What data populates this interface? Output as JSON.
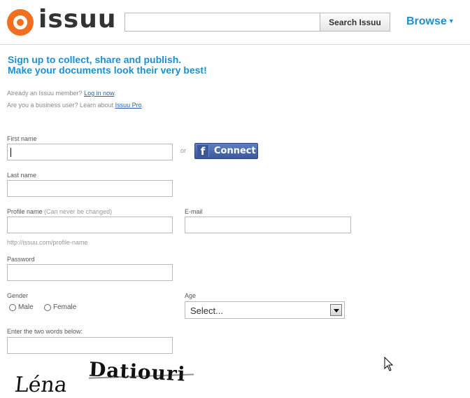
{
  "header": {
    "brand": "issuu",
    "search_placeholder": "",
    "search_button": "Search Issuu",
    "browse_label": "Browse"
  },
  "tagline": {
    "line1": "Sign up to collect, share and publish.",
    "line2": "Make your documents look their very best!"
  },
  "info": {
    "member_text": "Already an Issuu member?",
    "login_link": "Log in now",
    "business_text": "Are you a business user? Learn about",
    "pro_link": "Issuu Pro"
  },
  "form": {
    "first_name_label": "First name",
    "or_text": "or",
    "fb_connect": "Connect",
    "last_name_label": "Last name",
    "profile_name_label": "Profile name",
    "profile_name_hint": "(Can never be changed)",
    "email_label": "E-mail",
    "profile_url_hint": "http://issuu.com/profile-name",
    "password_label": "Password",
    "gender_label": "Gender",
    "gender_male": "Male",
    "gender_female": "Female",
    "age_label": "Age",
    "age_selected": "Select...",
    "captcha_label": "Enter the two words below:",
    "captcha_word1": "Léna",
    "captcha_word2": "Datiouri"
  },
  "colors": {
    "accent": "#1c8fd1",
    "logo": "#f26f21",
    "facebook": "#3b5998"
  }
}
